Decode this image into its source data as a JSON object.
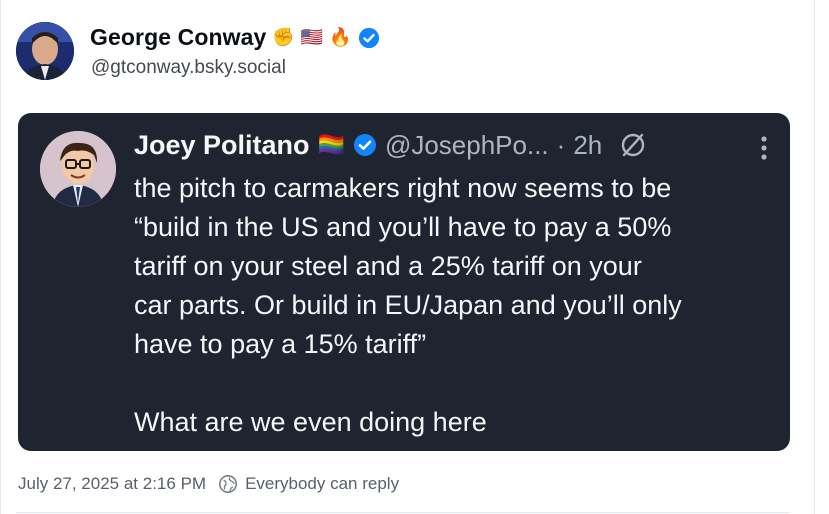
{
  "post": {
    "author": {
      "display_name": "George Conway",
      "emojis": [
        "✊",
        "🇺🇸",
        "🔥"
      ],
      "verified": true,
      "handle": "@gtconway.bsky.social"
    },
    "quoted_post": {
      "author": {
        "display_name": "Joey Politano",
        "emoji": "🏳️‍🌈",
        "verified": true,
        "handle": "@JosephPo...",
        "separator": "·",
        "age": "2h"
      },
      "text": "the pitch to carmakers right now seems to be\n“build in the US and you’ll have to pay a 50%\ntariff on your steel and a 25% tariff on your\ncar parts. Or build in EU/Japan and you’ll only\nhave to pay a 15% tariff”\n\nWhat are we even doing here"
    },
    "timestamp": "July 27, 2025 at 2:16 PM",
    "reply_setting": "Everybody can reply"
  },
  "icons": {
    "verified": "verified-badge-icon",
    "bridge": "bridged-post-icon",
    "more": "more-options-icon",
    "reply_setting": "globe-reply-icon"
  },
  "colors": {
    "verified": "#1185fe",
    "quote_background": "#1e2430",
    "quote_text": "#f4f6f8",
    "muted_text": "#59606b"
  }
}
